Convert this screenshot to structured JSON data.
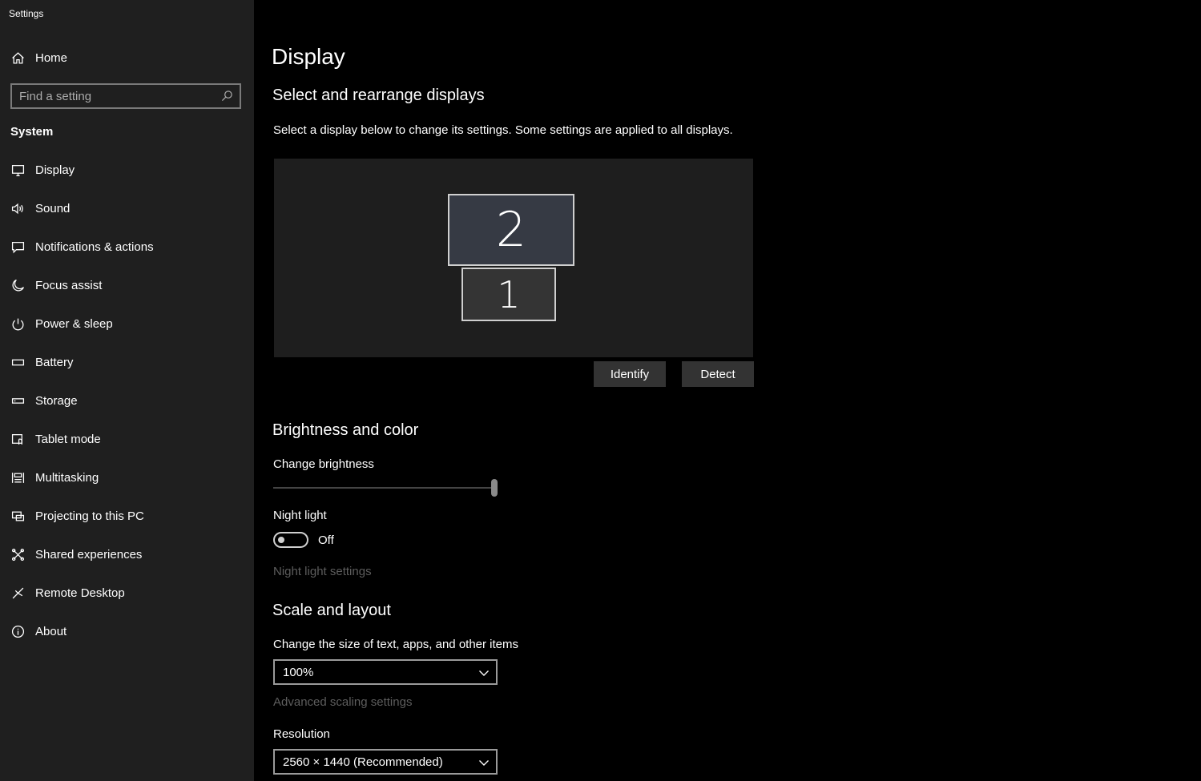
{
  "app": {
    "title": "Settings"
  },
  "sidebar": {
    "home_label": "Home",
    "search_placeholder": "Find a setting",
    "section_label": "System",
    "items": [
      {
        "label": "Display",
        "icon": "monitor-icon"
      },
      {
        "label": "Sound",
        "icon": "speaker-icon"
      },
      {
        "label": "Notifications & actions",
        "icon": "notification-icon"
      },
      {
        "label": "Focus assist",
        "icon": "moon-icon"
      },
      {
        "label": "Power & sleep",
        "icon": "power-icon"
      },
      {
        "label": "Battery",
        "icon": "battery-icon"
      },
      {
        "label": "Storage",
        "icon": "storage-icon"
      },
      {
        "label": "Tablet mode",
        "icon": "tablet-mode-icon"
      },
      {
        "label": "Multitasking",
        "icon": "multitasking-icon"
      },
      {
        "label": "Projecting to this PC",
        "icon": "projector-icon"
      },
      {
        "label": "Shared experiences",
        "icon": "shared-experiences-icon"
      },
      {
        "label": "Remote Desktop",
        "icon": "remote-desktop-icon"
      },
      {
        "label": "About",
        "icon": "info-icon"
      }
    ],
    "selected": "Display"
  },
  "main": {
    "title": "Display",
    "arrange": {
      "heading": "Select and rearrange displays",
      "description": "Select a display below to change its settings. Some settings are applied to all displays.",
      "monitor_upper_label": "2",
      "monitor_lower_label": "1",
      "identify_label": "Identify",
      "detect_label": "Detect"
    },
    "brightness": {
      "heading": "Brightness and color",
      "change_brightness_label": "Change brightness",
      "brightness_level": 1.0,
      "night_light_label": "Night light",
      "night_light_state": "Off",
      "night_light_settings_link": "Night light settings"
    },
    "scale": {
      "heading": "Scale and layout",
      "size_label": "Change the size of text, apps, and other items",
      "size_value": "100%",
      "advanced_link": "Advanced scaling settings",
      "resolution_label": "Resolution",
      "resolution_value": "2560 × 1440 (Recommended)"
    }
  }
}
